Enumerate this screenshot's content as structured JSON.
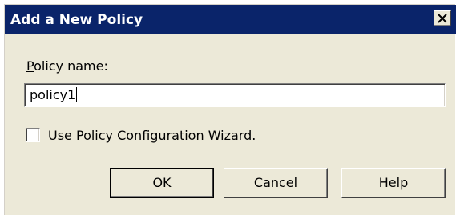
{
  "window": {
    "title": "Add a New Policy",
    "close_icon": "close-icon"
  },
  "form": {
    "policy_name_label_accesskey": "P",
    "policy_name_label_rest": "olicy name:",
    "policy_name_value": "policy1",
    "wizard_checkbox_checked": false,
    "wizard_label_accesskey": "U",
    "wizard_label_rest": "se Policy Configuration Wizard."
  },
  "buttons": {
    "ok": "OK",
    "cancel": "Cancel",
    "help": "Help"
  },
  "colors": {
    "titlebar": "#0a246a",
    "dialog_face": "#ece9d8",
    "title_text": "#ffffff"
  }
}
